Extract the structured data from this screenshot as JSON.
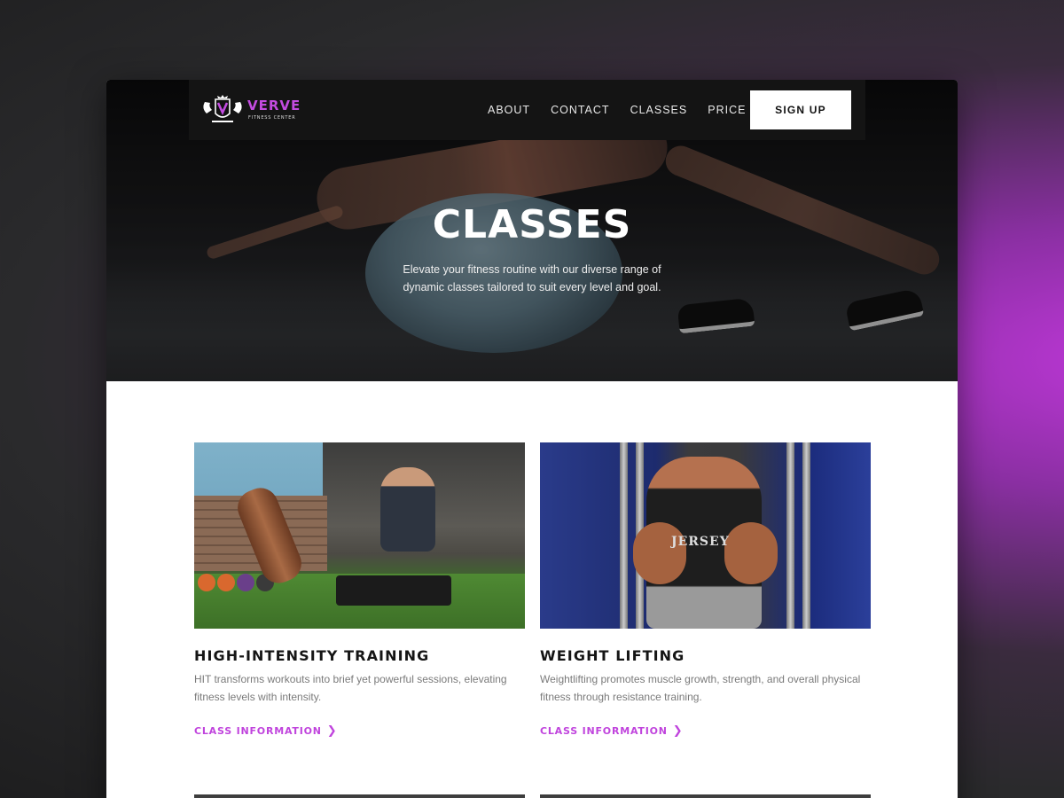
{
  "brand": {
    "name": "VERVE",
    "subtitle": "FITNESS CENTER",
    "accent_color": "#c044dd"
  },
  "nav": {
    "links": [
      "ABOUT",
      "CONTACT",
      "CLASSES",
      "PRICE"
    ],
    "signup_label": "SIGN UP"
  },
  "hero": {
    "title": "CLASSES",
    "description": "Elevate your fitness routine with our diverse range of dynamic classes tailored to suit every level and goal."
  },
  "classes": [
    {
      "title": "HIGH-INTENSITY TRAINING",
      "description": "HIT transforms workouts into brief yet powerful sessions, elevating fitness levels with intensity.",
      "link_label": "CLASS INFORMATION",
      "image_icon": "gym-sled-photo"
    },
    {
      "title": "WEIGHT LIFTING",
      "description": "Weightlifting promotes muscle growth, strength, and overall physical fitness through resistance training.",
      "link_label": "CLASS INFORMATION",
      "image_icon": "cable-crossover-photo",
      "jersey_text": "JERSEY"
    }
  ]
}
